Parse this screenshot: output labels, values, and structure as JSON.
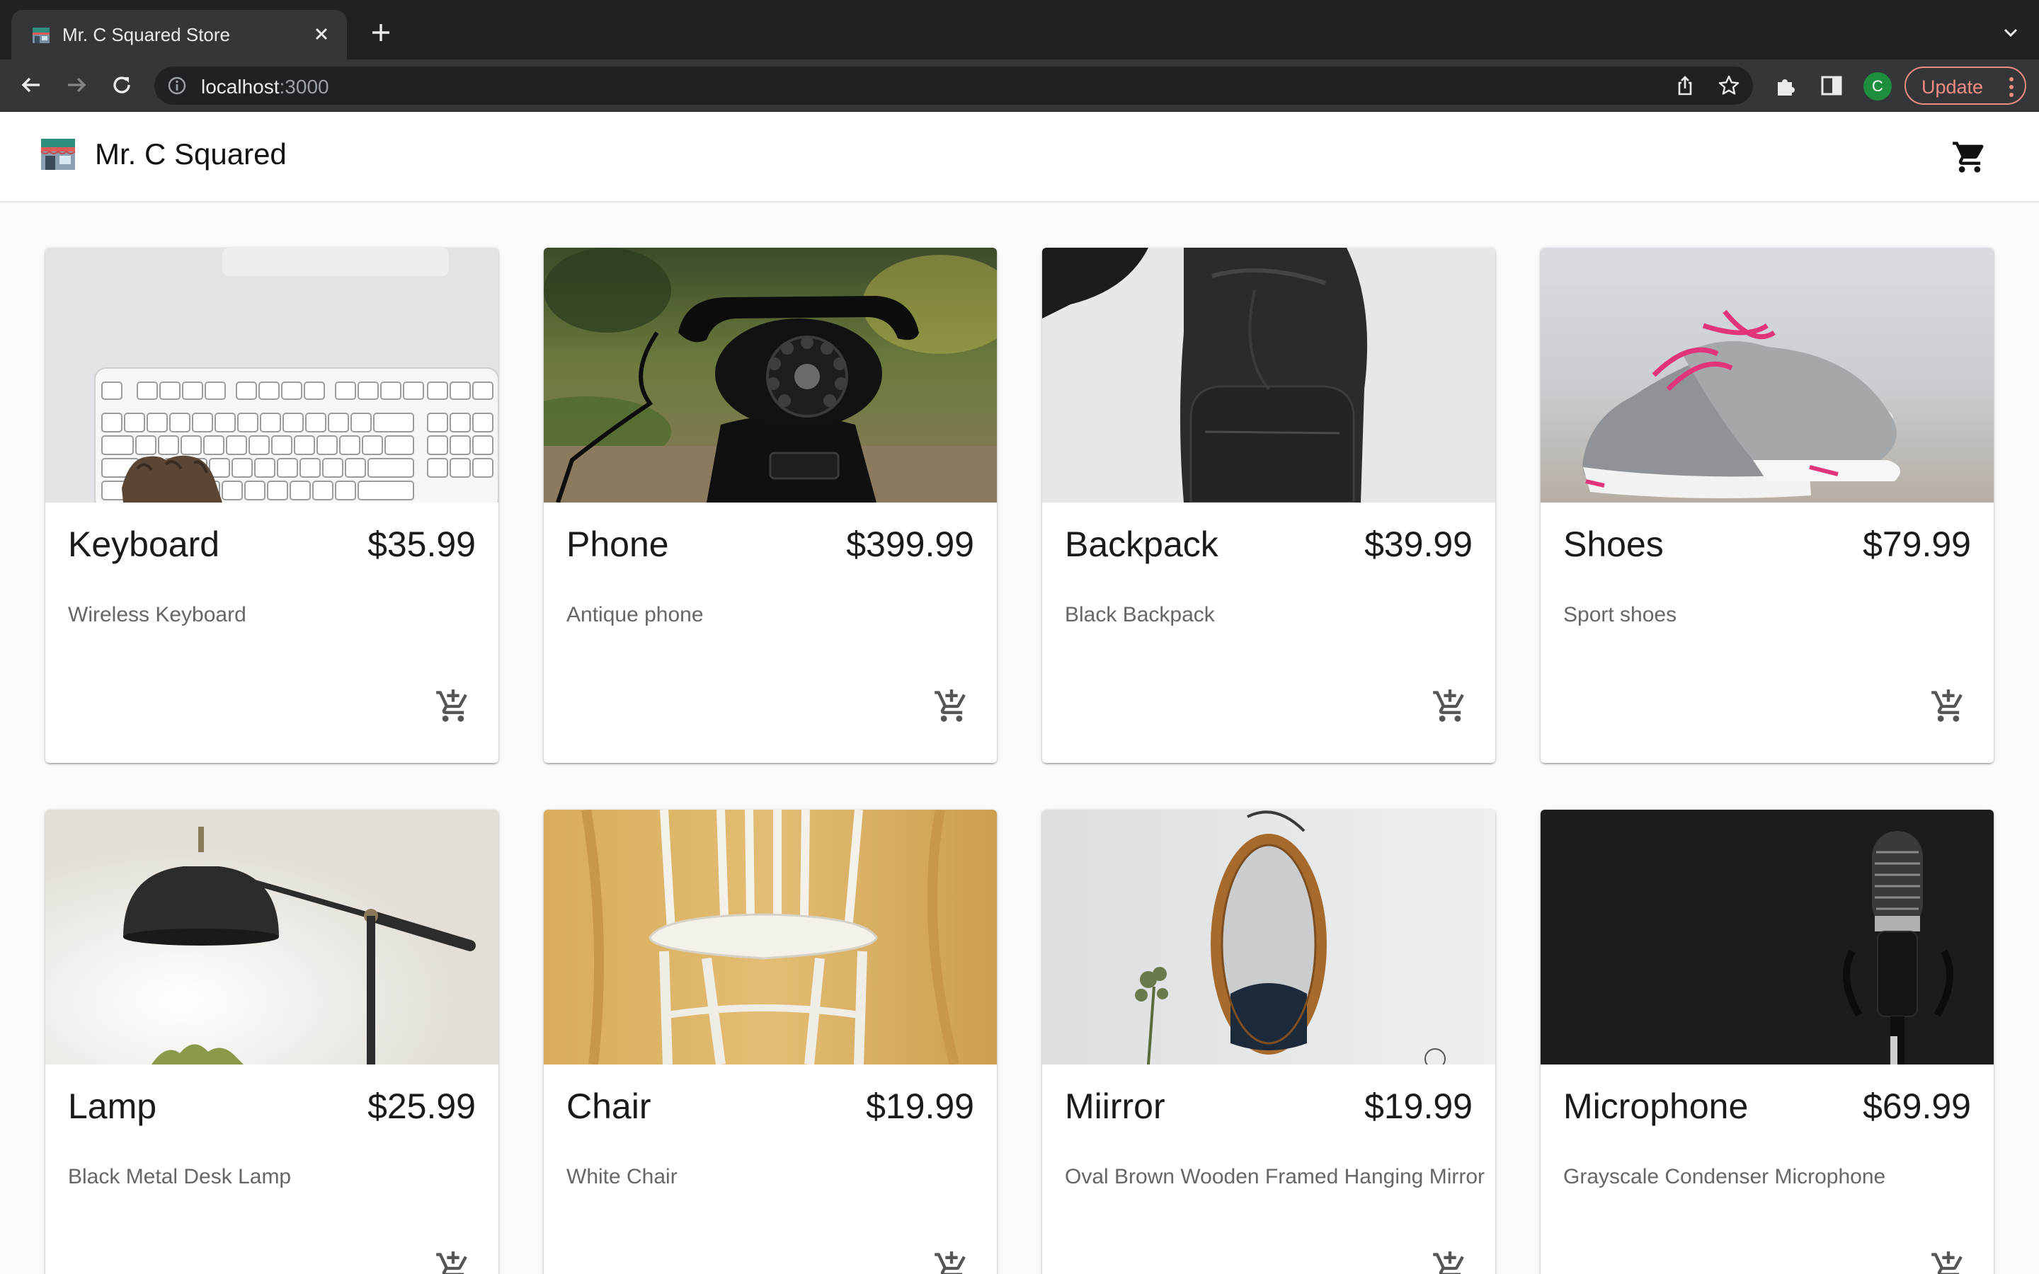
{
  "browser": {
    "tab_title": "Mr. C Squared Store",
    "url_host": "localhost",
    "url_port": ":3000",
    "profile_initial": "C",
    "update_label": "Update"
  },
  "app": {
    "brand": "Mr. C Squared"
  },
  "products": [
    {
      "name": "Keyboard",
      "price": "$35.99",
      "description": "Wireless Keyboard"
    },
    {
      "name": "Phone",
      "price": "$399.99",
      "description": "Antique phone"
    },
    {
      "name": "Backpack",
      "price": "$39.99",
      "description": "Black Backpack"
    },
    {
      "name": "Shoes",
      "price": "$79.99",
      "description": "Sport shoes"
    },
    {
      "name": "Lamp",
      "price": "$25.99",
      "description": "Black Metal Desk Lamp"
    },
    {
      "name": "Chair",
      "price": "$19.99",
      "description": "White Chair"
    },
    {
      "name": "Miirror",
      "price": "$19.99",
      "description": "Oval Brown Wooden Framed Hanging Mirror"
    },
    {
      "name": "Microphone",
      "price": "$69.99",
      "description": "Grayscale Condenser Microphone"
    }
  ],
  "icons": {
    "cart": "shopping-cart-icon",
    "add_to_cart": "add-shopping-cart-icon"
  }
}
